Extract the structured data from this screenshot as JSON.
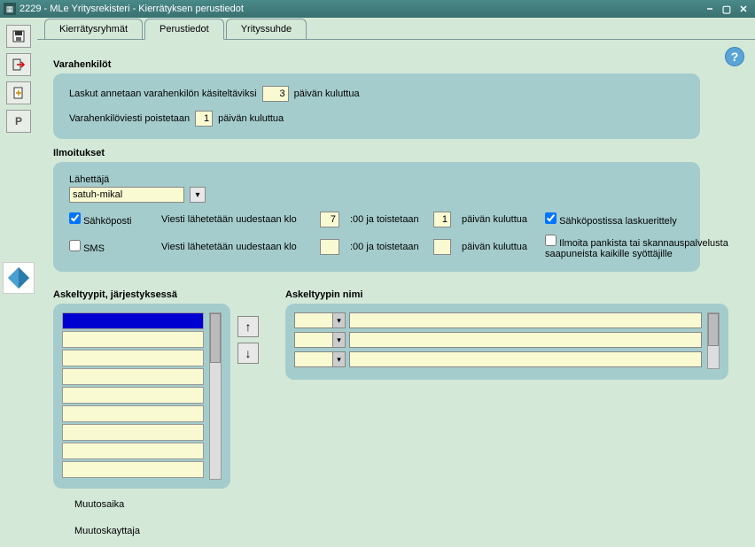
{
  "window": {
    "title": "2229 - MLe Yritysrekisteri - Kierrätyksen perustiedot"
  },
  "tabs": {
    "t1": "Kierrätysryhmät",
    "t2": "Perustiedot",
    "t3": "Yrityssuhde"
  },
  "help": "?",
  "varahenkilot": {
    "title": "Varahenkilöt",
    "lbl_laskut_pre": "Laskut annetaan varahenkilön käsiteltäviksi",
    "val_laskut": "3",
    "lbl_laskut_post": "päivän kuluttua",
    "lbl_poist_pre": "Varahenkilöviesti poistetaan",
    "val_poist": "1",
    "lbl_poist_post": "päivän kuluttua"
  },
  "ilmoitukset": {
    "title": "Ilmoitukset",
    "lahettaja_lbl": "Lähettäjä",
    "lahettaja_val": "satuh-mikal",
    "chk_sahkoposti": "Sähköposti",
    "chk_sms": "SMS",
    "lbl_viesti": "Viesti lähetetään uudestaan klo",
    "val_klo1": "7",
    "lbl_toist": ":00 ja toistetaan",
    "lbl_toist2": ":00 ja  toistetaan",
    "val_toist1": "1",
    "lbl_post": "päivän kuluttua",
    "val_klo2": "",
    "val_toist2": "",
    "chk_erittely": "Sähköpostissa laskuerittely",
    "chk_ilmoita": "Ilmoita pankista tai skannauspalvelusta saapuneista kaikille syöttäjille"
  },
  "askel": {
    "title": "Askeltyypit, järjestyksessä",
    "nimi_title": "Askeltyypin nimi",
    "muutosaika": "Muutosaika",
    "muutoskayttaja": "Muutoskayttaja"
  }
}
